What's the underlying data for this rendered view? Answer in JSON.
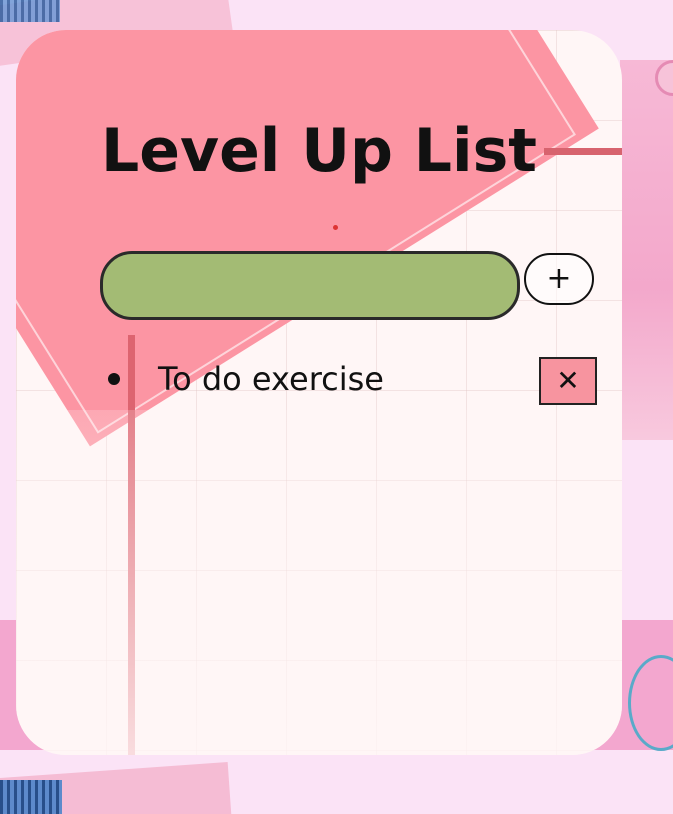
{
  "app": {
    "title": "Level Up List"
  },
  "input": {
    "value": "",
    "placeholder": ""
  },
  "add_button": {
    "label": "+"
  },
  "tasks": [
    {
      "text": "To do exercise",
      "delete_label": "✕"
    }
  ],
  "colors": {
    "input_bg": "#a3bb74",
    "delete_bg": "#f7949f",
    "page_bg": "#fbe3f6",
    "accent_pink": "#fc95a3"
  },
  "icons": {
    "add": "plus-icon",
    "delete": "close-icon",
    "bullet": "bullet-icon"
  }
}
